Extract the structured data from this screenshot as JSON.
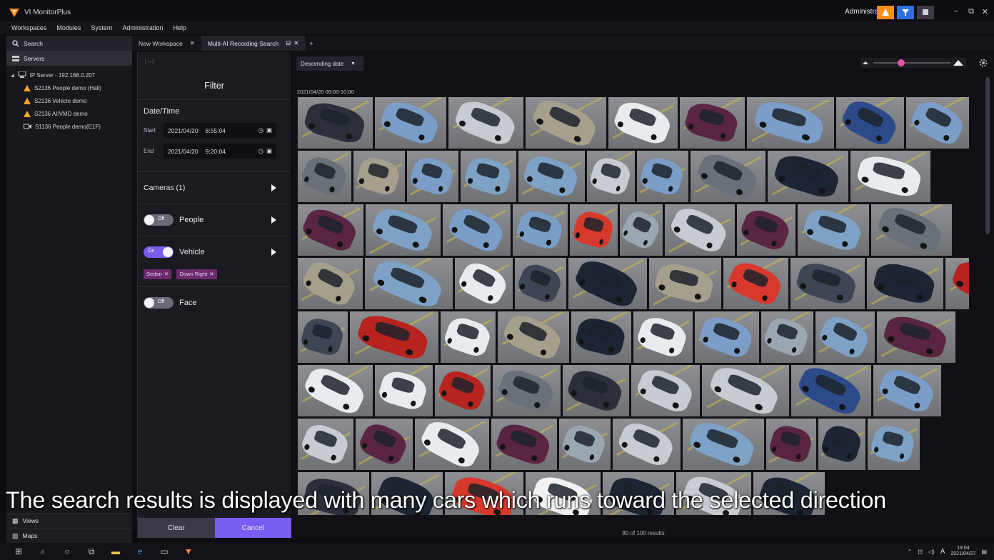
{
  "app": {
    "title": "VI MonitorPlus",
    "user": "Administrator",
    "brand_color": "#ff8c1a",
    "accent_color": "#7b5cf0"
  },
  "menu": [
    "Workspaces",
    "Modules",
    "System",
    "Administration",
    "Help"
  ],
  "left_panel": {
    "search_label": "Search",
    "servers_label": "Servers",
    "server_name": "IP Server - 192.168.0.207",
    "cameras": [
      {
        "label": "S2136 People demo (Hall)",
        "icon": "warning-icon"
      },
      {
        "label": "S2136 Vehicle demo",
        "icon": "warning-icon"
      },
      {
        "label": "S2136 AI/VMD demo",
        "icon": "warning-icon"
      },
      {
        "label": "S1136 People demo(E1F)",
        "icon": "camera-icon"
      }
    ],
    "bottom": [
      {
        "label": "Views",
        "icon": "grid-icon"
      },
      {
        "label": "Maps",
        "icon": "map-icon"
      }
    ]
  },
  "tabs": [
    {
      "label": "New Workspace",
      "active": false
    },
    {
      "label": "Multi-AI Recording Search",
      "active": true
    }
  ],
  "filter": {
    "title": "Filter",
    "datetime_title": "Date/Time",
    "start_label": "Start",
    "start_date": "2021/04/20",
    "start_time": "8:55:04",
    "end_label": "End",
    "end_date": "2021/04/20",
    "end_time": "9:20:04",
    "cameras_label": "Cameras (1)",
    "people": {
      "label": "People",
      "state": "Off"
    },
    "vehicle": {
      "label": "Vehicle",
      "state": "On",
      "chips": [
        "Sedan",
        "Down Right"
      ]
    },
    "face": {
      "label": "Face",
      "state": "Off"
    },
    "clear_label": "Clear",
    "cancel_label": "Cancel"
  },
  "results": {
    "sort_label": "Descending date",
    "date_group": "2021/04/20 09:00-10:00",
    "count_text": "80 of 100 results"
  },
  "caption": "The search results is displayed with many cars which runs toward the selected direction",
  "taskbar": {
    "clock_time": "19:04",
    "clock_date": "2021/04/27",
    "lang": "A"
  }
}
